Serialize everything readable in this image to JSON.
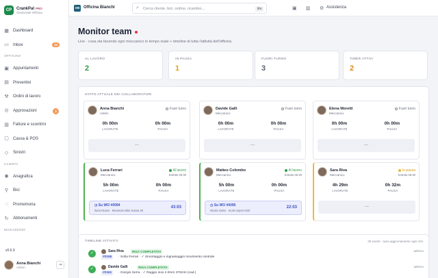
{
  "brand": {
    "name": "CrankPal",
    "badge": "PRO",
    "subtitle": "Gestionale Officina",
    "logo": "CP"
  },
  "sidebar": {
    "items": [
      {
        "label": "Dashboard",
        "icon": "grid-icon",
        "glyph": "▦"
      },
      {
        "label": "Inbox",
        "icon": "inbox-icon",
        "glyph": "▭",
        "badge": "14"
      }
    ],
    "section_officina": "OFFICINA",
    "officina_items": [
      {
        "label": "Appuntamenti",
        "icon": "calendar-icon",
        "glyph": "▣"
      },
      {
        "label": "Preventivi",
        "icon": "document-icon",
        "glyph": "▤"
      },
      {
        "label": "Ordini di lavoro",
        "icon": "wrench-icon",
        "glyph": "⚒"
      },
      {
        "label": "Approvazioni",
        "icon": "check-circle-icon",
        "glyph": "◎",
        "badge": "3"
      },
      {
        "label": "Fatture e scontrini",
        "icon": "receipt-icon",
        "glyph": "▥"
      },
      {
        "label": "Cassa & POS",
        "icon": "cash-register-icon",
        "glyph": "▢"
      },
      {
        "label": "Sinistri",
        "icon": "shield-icon",
        "glyph": "◇"
      }
    ],
    "section_clienti": "CLIENTI",
    "clienti_items": [
      {
        "label": "Anagrafica",
        "icon": "users-icon",
        "glyph": "◉"
      },
      {
        "label": "Bici",
        "icon": "bike-icon",
        "glyph": "⚲"
      },
      {
        "label": "Promemoria",
        "icon": "bell-icon",
        "glyph": "◌"
      },
      {
        "label": "Abbonamenti",
        "icon": "refresh-icon",
        "glyph": "↻"
      }
    ],
    "section_magazzino": "MAGAZZINO",
    "version": "v0.6.9",
    "user": {
      "name": "Anna Bianchi",
      "role": "Admin"
    }
  },
  "topbar": {
    "shop_name": "Officina Bianchi",
    "shop_logo": "OB",
    "search_placeholder": "Cerca cliente, bici, ordine, ricambio...",
    "search_shortcut": "⌘K",
    "assist_label": "Assistenza"
  },
  "page": {
    "title": "Monitor team",
    "subtitle": "Live · cosa sta facendo ogni meccanico in tempo reale + timeline di tutta l'attività dell'officina"
  },
  "stats": [
    {
      "label": "AL LAVORO",
      "value": "2",
      "color": "#2e9c48"
    },
    {
      "label": "IN PAUSA",
      "value": "1",
      "color": "#e0a21a"
    },
    {
      "label": "FUORI TURNO",
      "value": "3",
      "color": "#5a6070"
    },
    {
      "label": "TIMER ATTIVI",
      "value": "2",
      "color": "#e08a1a"
    }
  ],
  "team": {
    "title": "STATO ATTUALE DEI COLLABORATORI",
    "work_label": "LAVORATE",
    "pause_label": "PAUSA",
    "members": [
      {
        "name": "Anna Bianchi",
        "role": "Admin",
        "status": "Fuori turno",
        "status_kind": "off",
        "since": "",
        "work": "0h 00m",
        "pause": "0h 00m",
        "empty": "—"
      },
      {
        "name": "Davide Galli",
        "role": "Meccanico",
        "status": "Fuori turno",
        "status_kind": "off",
        "since": "",
        "work": "0h 00m",
        "pause": "0h 00m",
        "empty": "—"
      },
      {
        "name": "Elena Moretti",
        "role": "Meccanico",
        "status": "Fuori turno",
        "status_kind": "off",
        "since": "",
        "work": "0h 00m",
        "pause": "0h 00m",
        "empty": "—"
      },
      {
        "name": "Luca Ferrari",
        "role": "Meccanico",
        "status": "Al lavoro",
        "status_kind": "on",
        "since": "Entrato 05:30",
        "work": "5h 00m",
        "pause": "0h 00m",
        "wo": {
          "title": "Su WO #0094",
          "desc": "Ilaria Russo · Mountain Bike Sansa 29",
          "time": "43:03"
        }
      },
      {
        "name": "Matteo Colombo",
        "role": "Meccanico",
        "status": "Al lavoro",
        "status_kind": "on",
        "since": "Entrato 05:30",
        "work": "5h 00m",
        "pause": "0h 00m",
        "wo": {
          "title": "Su WO #0095",
          "desc": "Nicola Gatto · Scott Aspect 940",
          "time": "22:03"
        }
      },
      {
        "name": "Sara Riva",
        "role": "Meccanico",
        "status": "In pausa",
        "status_kind": "pause",
        "since": "Entrato 05:30",
        "work": "4h 29m",
        "pause": "0h 32m",
        "empty": "—"
      }
    ]
  },
  "timeline": {
    "title": "TIMELINE ATTIVITÀ",
    "meta": "30 eventi · auto-aggiornamento ogni 10s",
    "events": [
      {
        "name": "Sara Riva",
        "tag": "RIGA COMPLETATA",
        "wo": "#0155",
        "desc": "· Sofia Ferrari · ✓ Smontaggio e ingrassaggio movimento centrale",
        "time": "adesso"
      },
      {
        "name": "Davide Galli",
        "tag": "RIGA COMPLETATA",
        "wo": "#0161",
        "desc": "· Giorgio Serra · ✓ Raggio inox 2.0mm 276mm (cad.)",
        "time": "adesso"
      }
    ]
  }
}
